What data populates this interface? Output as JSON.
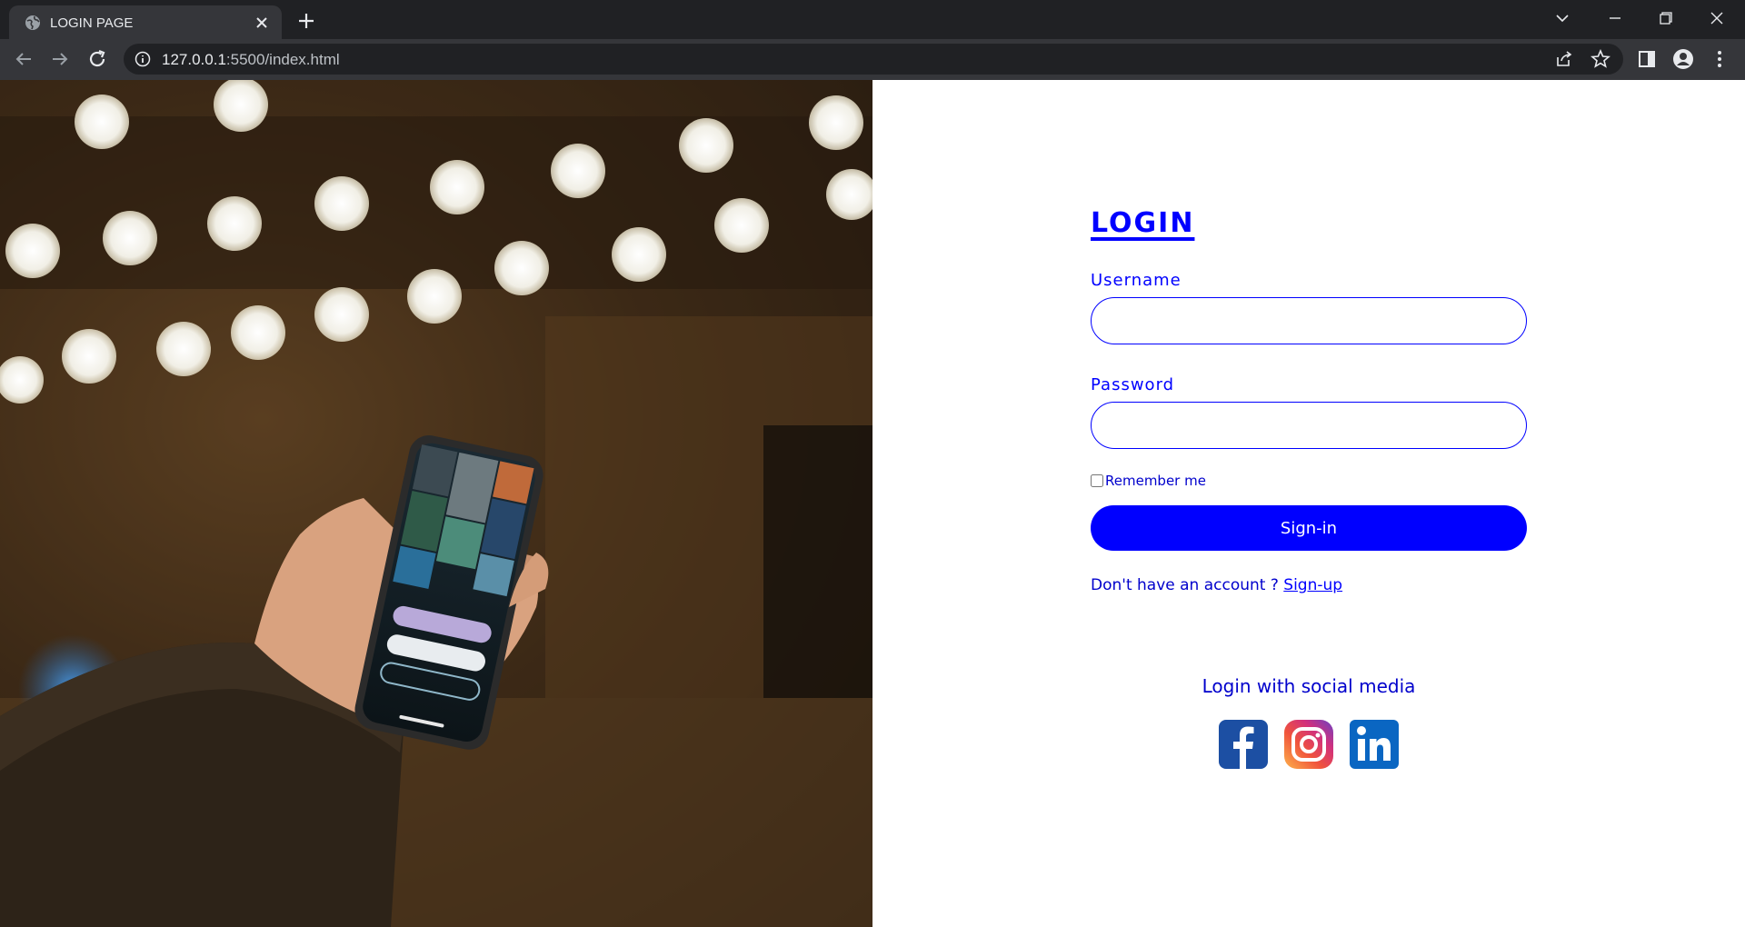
{
  "browser": {
    "tab_title": "LOGIN PAGE",
    "url_host": "127.0.0.1",
    "url_rest": ":5500/index.html"
  },
  "login": {
    "title": "LOGIN",
    "username_label": "Username",
    "username_value": "",
    "password_label": "Password",
    "password_value": "",
    "remember_label": "Remember me",
    "signin_label": "Sign-in",
    "no_account_text": "Don't have an account ? ",
    "signup_link": "Sign-up"
  },
  "social": {
    "title": "Login with social media",
    "icons": [
      "facebook-icon",
      "instagram-icon",
      "linkedin-icon"
    ]
  },
  "colors": {
    "accent": "#0000ff",
    "chrome_dark": "#202124",
    "chrome_toolbar": "#35363a"
  }
}
